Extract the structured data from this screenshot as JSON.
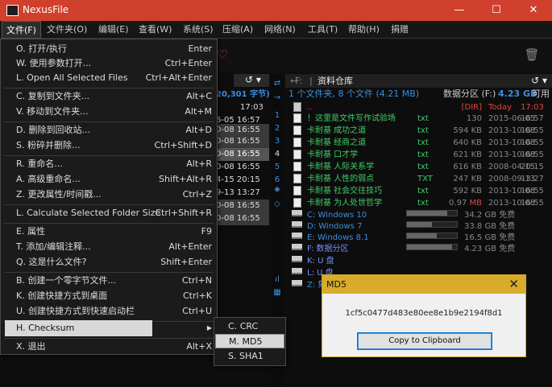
{
  "window": {
    "title": "NexusFile",
    "min_glyph": "—",
    "max_glyph": "☐",
    "close_glyph": "✕"
  },
  "menubar": [
    "文件(F)",
    "文件夹(O)",
    "编辑(E)",
    "查看(W)",
    "系统(S)",
    "压缩(A)",
    "网络(N)",
    "工具(T)",
    "帮助(H)",
    "捐赠"
  ],
  "file_menu": {
    "items": [
      {
        "key": "O.",
        "label": "打开/执行",
        "shortcut": "Enter"
      },
      {
        "key": "W.",
        "label": "使用参数打开...",
        "shortcut": "Ctrl+Enter"
      },
      {
        "key": "L.",
        "label": "Open All Selected Files",
        "shortcut": "Ctrl+Alt+Enter"
      },
      {
        "key": "C.",
        "label": "复制到文件夹...",
        "shortcut": "Alt+C"
      },
      {
        "key": "V.",
        "label": "移动到文件夹...",
        "shortcut": "Alt+M"
      },
      {
        "key": "D.",
        "label": "删除到回收站...",
        "shortcut": "Alt+D"
      },
      {
        "key": "S.",
        "label": "粉碎并删除...",
        "shortcut": "Ctrl+Shift+D"
      },
      {
        "key": "R.",
        "label": "重命名...",
        "shortcut": "Alt+R"
      },
      {
        "key": "A.",
        "label": "高级重命名...",
        "shortcut": "Shift+Alt+R"
      },
      {
        "key": "Z.",
        "label": "更改属性/时间戳...",
        "shortcut": "Ctrl+Z"
      },
      {
        "key": "L.",
        "label": "Calculate Selected Folder Size",
        "shortcut": "Ctrl+Shift+R"
      },
      {
        "key": "E.",
        "label": "属性",
        "shortcut": "F9"
      },
      {
        "key": "T.",
        "label": "添加/编辑注释...",
        "shortcut": "Alt+Enter"
      },
      {
        "key": "Q.",
        "label": "这是什么文件?",
        "shortcut": "Shift+Enter"
      },
      {
        "key": "B.",
        "label": "创建一个零字节文件...",
        "shortcut": "Ctrl+N"
      },
      {
        "key": "K.",
        "label": "创建快捷方式到桌面",
        "shortcut": "Ctrl+K"
      },
      {
        "key": "U.",
        "label": "创建快捷方式到快速启动栏",
        "shortcut": "Ctrl+U"
      },
      {
        "key": "H.",
        "label": "Checksum",
        "shortcut": ""
      },
      {
        "key": "X.",
        "label": "退出",
        "shortcut": "Alt+X"
      }
    ]
  },
  "checksum_submenu": [
    {
      "key": "C.",
      "label": "CRC"
    },
    {
      "key": "M.",
      "label": "MD5"
    },
    {
      "key": "S.",
      "label": "SHA1"
    }
  ],
  "left_panel": {
    "header_glyphs": "↺ ▾",
    "size_text": "20,301 字节)",
    "time_head": "17:03",
    "rows": [
      "6-05  16:57",
      "0-08  16:55",
      "0-08  16:55",
      "0-08  16:55",
      "0-08  16:55",
      "4-15  20:15",
      "9-13  13:27",
      "0-08  16:55",
      "0-08  16:55"
    ]
  },
  "middle_icons": [
    "⇄",
    "→",
    "1",
    "2",
    "3",
    "4",
    "5",
    "6",
    "◈",
    "◇",
    "ıl",
    "▦"
  ],
  "right_panel": {
    "path_drive": "F:",
    "path_folder": "资料仓库",
    "header_glyphs": "↺ ▾",
    "info_left": "1 个文件夹, 8 个文件 (4.21 MB)",
    "info_right_label": "数据分区 (F:)",
    "info_right_free": "4.23 GB",
    "info_right_suffix": "可用",
    "parent": {
      "name": "..",
      "type": "[DIR]",
      "date": "Today",
      "time": "17:03"
    },
    "files": [
      {
        "name": "！这里是文件写作试验场",
        "ext": "txt",
        "size": "130",
        "date": "2015-06-05",
        "time": "16:57"
      },
      {
        "name": "卡耐基 成功之道",
        "ext": "txt",
        "size": "594 KB",
        "date": "2013-10-08",
        "time": "16:55"
      },
      {
        "name": "卡耐基 经商之道",
        "ext": "txt",
        "size": "640 KB",
        "date": "2013-10-08",
        "time": "16:55"
      },
      {
        "name": "卡耐基 口才学",
        "ext": "txt",
        "size": "621 KB",
        "date": "2013-10-08",
        "time": "16:55"
      },
      {
        "name": "卡耐基 人际关系学",
        "ext": "txt",
        "size": "616 KB",
        "date": "2008-04-15",
        "time": "20:15"
      },
      {
        "name": "卡耐基 人性的弱点",
        "ext": "TXT",
        "size": "247 KB",
        "date": "2008-09-13",
        "time": "13:27"
      },
      {
        "name": "卡耐基 社会交往技巧",
        "ext": "txt",
        "size": "592 KB",
        "date": "2013-10-08",
        "time": "16:55"
      },
      {
        "name": "卡耐基 为人处世哲学",
        "ext": "txt",
        "size_num": "0.97",
        "size_unit": "MB",
        "date": "2013-10-08",
        "time": "16:55"
      }
    ],
    "drives": [
      {
        "name": "C: Windows 10",
        "used": 0.8,
        "free": "34.2 GB 免费"
      },
      {
        "name": "D: Windows 7",
        "used": 0.5,
        "free": "33.8 GB 免费"
      },
      {
        "name": "E: Windows 8.1",
        "used": 0.6,
        "free": "16.5 GB 免费"
      },
      {
        "name": "F: 数据分区",
        "used": 0.9,
        "free": "4.23 GB 免费"
      },
      {
        "name": "K: U 盘",
        "used": null,
        "free": ""
      },
      {
        "name": "L: U 盘",
        "used": null,
        "free": ""
      },
      {
        "name": "Z: 集",
        "used": null,
        "free": ""
      }
    ]
  },
  "md5_dialog": {
    "title": "MD5",
    "close_glyph": "✕",
    "hash": "1cf5c0477d483e80ee8e1b9e2194f8d1",
    "button": "Copy to Clipboard"
  },
  "colors": {
    "titlebar": "#d0402c",
    "accent_blue": "#3b8ee0",
    "file_green": "#3fcf68",
    "dir_red": "#e0443a",
    "dialog_title": "#d8ab2a"
  }
}
